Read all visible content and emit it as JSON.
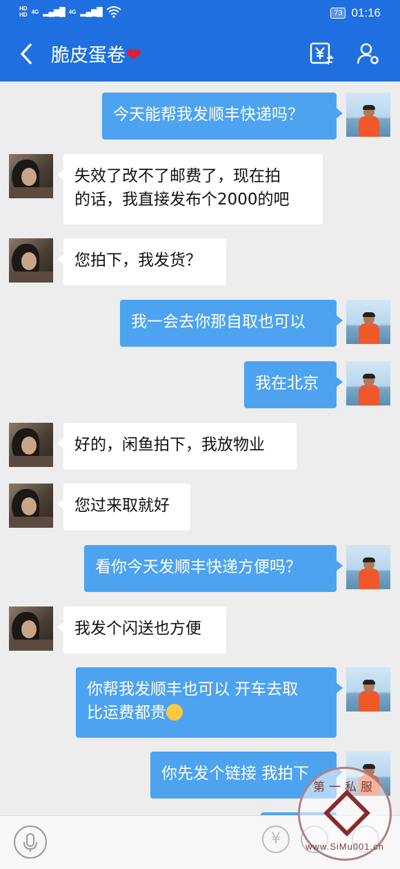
{
  "status_bar": {
    "hd1": "HD",
    "hd2": "HD",
    "net1": "4G",
    "net2": "4G",
    "battery": "73",
    "time": "01:16"
  },
  "header": {
    "title": "脆皮蛋卷",
    "heart": "❤",
    "back_icon": "chevron-left-icon",
    "money_icon": "yen-transfer-icon",
    "profile_icon": "user-settings-icon"
  },
  "messages": [
    {
      "from": "me",
      "text": "今天能帮我发顺丰快递吗？"
    },
    {
      "from": "them",
      "text": "失效了改不了邮费了，现在拍\n的话，我直接发布个2000的吧"
    },
    {
      "from": "them",
      "text": "您拍下，我发货？"
    },
    {
      "from": "me",
      "text": "我一会去你那自取也可以"
    },
    {
      "from": "me",
      "text": "我在北京"
    },
    {
      "from": "them",
      "text": "好的，闲鱼拍下，我放物业"
    },
    {
      "from": "them",
      "text": "您过来取就好"
    },
    {
      "from": "me",
      "text": "看你今天发顺丰快递方便吗？"
    },
    {
      "from": "them",
      "text": "我发个闪送也方便"
    },
    {
      "from": "me",
      "text": "你帮我发顺丰也可以 开车去取\n比运费都贵",
      "emoji": "smiling-face-emoji"
    },
    {
      "from": "me",
      "text": "你先发个链接 我拍下"
    }
  ],
  "input_bar": {
    "placeholder": "",
    "yen_symbol": "¥",
    "mic_icon": "microphone-icon",
    "emoji_icon": "smile-icon",
    "plus_icon": "plus-icon"
  },
  "watermark": {
    "top_text": "第一私服",
    "bottom_text": "www.SiMu001.cn"
  },
  "colors": {
    "header_blue": "#1f6fe0",
    "my_bubble": "#4da3f0",
    "their_bubble": "#ffffff",
    "heart_red": "#e01e2e",
    "background": "#ededed"
  }
}
